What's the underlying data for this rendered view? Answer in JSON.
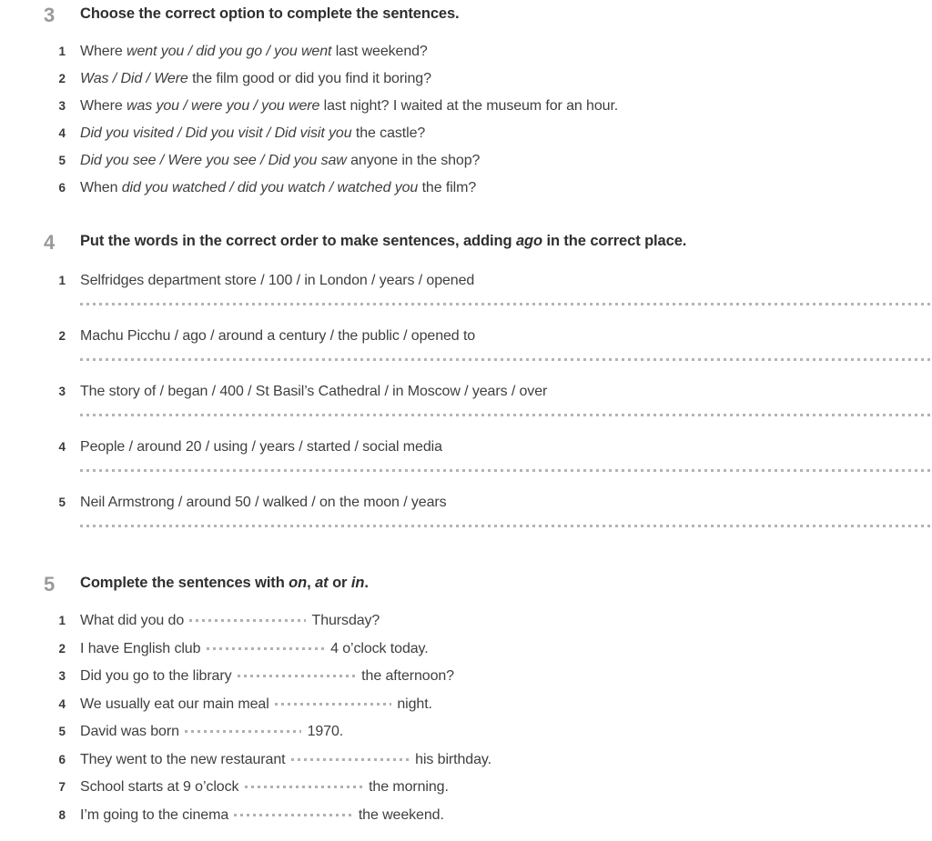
{
  "page": {
    "background_color": "#ffffff",
    "text_color": "#3f3f3f",
    "exercise_number_color": "#9a9a9a",
    "dot_color": "#b4b4b4"
  },
  "exercises": [
    {
      "number": "3",
      "heading_parts": [
        {
          "text": "Choose the correct option to complete the sentences.",
          "style": "normal"
        }
      ],
      "heading_plain": "Choose the correct option to complete the sentences.",
      "items": [
        {
          "number": "1",
          "parts": [
            {
              "text": "Where ",
              "style": "normal"
            },
            {
              "text": "went you / did you go / you went",
              "style": "italic"
            },
            {
              "text": " last weekend?",
              "style": "normal"
            }
          ],
          "plain": "Where went you / did you go / you went last weekend?"
        },
        {
          "number": "2",
          "parts": [
            {
              "text": "Was / Did / Were",
              "style": "italic"
            },
            {
              "text": " the film good or did you find it boring?",
              "style": "normal"
            }
          ],
          "plain": "Was / Did / Were the film good or did you find it boring?"
        },
        {
          "number": "3",
          "parts": [
            {
              "text": "Where ",
              "style": "normal"
            },
            {
              "text": "was you / were you / you were",
              "style": "italic"
            },
            {
              "text": " last night? I waited at the museum for an hour.",
              "style": "normal"
            }
          ],
          "plain": "Where was you / were you / you were last night? I waited at the museum for an hour."
        },
        {
          "number": "4",
          "parts": [
            {
              "text": "Did you visited / Did you visit / Did visit you",
              "style": "italic"
            },
            {
              "text": " the castle?",
              "style": "normal"
            }
          ],
          "plain": "Did you visited / Did you visit / Did visit you the castle?"
        },
        {
          "number": "5",
          "parts": [
            {
              "text": "Did you see / Were you see / Did you saw",
              "style": "italic"
            },
            {
              "text": " anyone in the shop?",
              "style": "normal"
            }
          ],
          "plain": "Did you see / Were you see / Did you saw anyone in the shop?"
        },
        {
          "number": "6",
          "parts": [
            {
              "text": "When ",
              "style": "normal"
            },
            {
              "text": "did you watched / did you watch / watched you",
              "style": "italic"
            },
            {
              "text": " the film?",
              "style": "normal"
            }
          ],
          "plain": "When did you watched / did you watch / watched you the film?"
        }
      ]
    },
    {
      "number": "4",
      "heading_parts": [
        {
          "text": "Put the words in the correct order to make sentences, adding ",
          "style": "normal"
        },
        {
          "text": "ago",
          "style": "italic"
        },
        {
          "text": " in the correct place.",
          "style": "normal"
        }
      ],
      "heading_plain": "Put the words in the correct order to make sentences, adding ago in the correct place.",
      "items": [
        {
          "number": "1",
          "parts": [
            {
              "text": "Selfridges department store / 100 / in London / years / opened",
              "style": "normal"
            }
          ],
          "plain": "Selfridges department store / 100 / in London / years / opened",
          "answer_line": true
        },
        {
          "number": "2",
          "parts": [
            {
              "text": "Machu Picchu / ago / around a century / the public / opened to",
              "style": "normal"
            }
          ],
          "plain": "Machu Picchu / ago / around a century / the public / opened to",
          "answer_line": true
        },
        {
          "number": "3",
          "parts": [
            {
              "text": "The story of / began / 400 / St Basil’s Cathedral / in Moscow / years / over",
              "style": "normal"
            }
          ],
          "plain": "The story of / began / 400 / St Basil’s Cathedral / in Moscow / years / over",
          "answer_line": true
        },
        {
          "number": "4",
          "parts": [
            {
              "text": "People / around 20 / using / years / started / social media",
              "style": "normal"
            }
          ],
          "plain": "People / around 20 / using / years / started / social media",
          "answer_line": true
        },
        {
          "number": "5",
          "parts": [
            {
              "text": "Neil Armstrong / around 50 / walked / on the moon / years",
              "style": "normal"
            }
          ],
          "plain": "Neil Armstrong / around 50 / walked / on the moon / years",
          "answer_line": true
        }
      ]
    },
    {
      "number": "5",
      "heading_parts": [
        {
          "text": "Complete the sentences with ",
          "style": "normal"
        },
        {
          "text": "on",
          "style": "italic"
        },
        {
          "text": ", ",
          "style": "normal"
        },
        {
          "text": "at",
          "style": "italic"
        },
        {
          "text": " or ",
          "style": "normal"
        },
        {
          "text": "in",
          "style": "italic"
        },
        {
          "text": ".",
          "style": "normal"
        }
      ],
      "heading_plain": "Complete the sentences with on, at or in.",
      "items": [
        {
          "number": "1",
          "before": "What did you do",
          "gap_width": 128,
          "after": "Thursday?",
          "plain": "What did you do … Thursday?"
        },
        {
          "number": "2",
          "before": "I have English club",
          "gap_width": 130,
          "after": "4 o’clock today.",
          "plain": "I have English club … 4 o’clock today."
        },
        {
          "number": "3",
          "before": "Did you go to the library",
          "gap_width": 130,
          "after": "the afternoon?",
          "plain": "Did you go to the library … the afternoon?"
        },
        {
          "number": "4",
          "before": "We usually eat our main meal",
          "gap_width": 128,
          "after": "night.",
          "plain": "We usually eat our main meal … night."
        },
        {
          "number": "5",
          "before": "David was born",
          "gap_width": 128,
          "after": "1970.",
          "plain": "David was born … 1970."
        },
        {
          "number": "6",
          "before": "They went to the new restaurant",
          "gap_width": 130,
          "after": "his birthday.",
          "plain": "They went to the new restaurant … his birthday."
        },
        {
          "number": "7",
          "before": "School starts at 9 o’clock",
          "gap_width": 130,
          "after": "the morning.",
          "plain": "School starts at 9 o’clock … the morning."
        },
        {
          "number": "8",
          "before": "I’m going to the cinema",
          "gap_width": 130,
          "after": "the weekend.",
          "plain": "I’m going to the cinema … the weekend."
        }
      ]
    }
  ]
}
